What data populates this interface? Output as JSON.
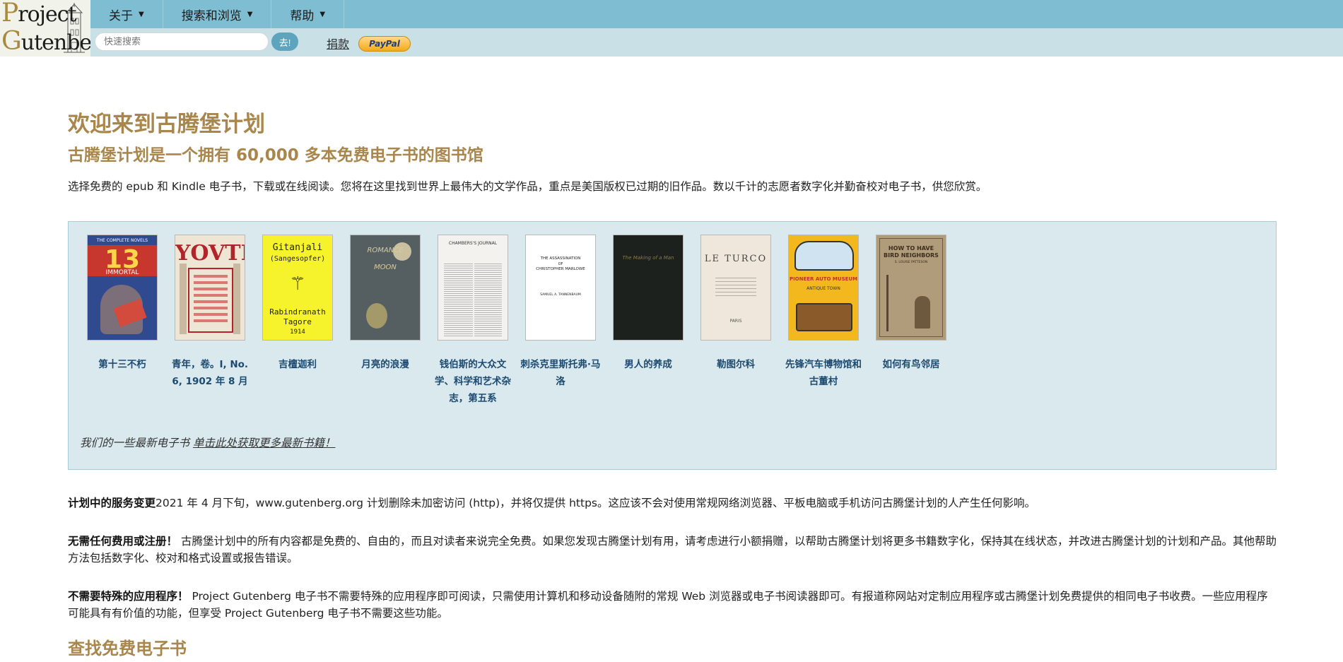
{
  "header": {
    "logo": {
      "line1": "Project",
      "line2": "Gutenberg"
    },
    "nav": [
      {
        "label": "关于"
      },
      {
        "label": "搜索和浏览"
      },
      {
        "label": "帮助"
      }
    ],
    "search": {
      "placeholder": "快速搜索",
      "value": ""
    },
    "go_label": "去!",
    "donate_label": "捐款",
    "paypal_label": "PayPal"
  },
  "main": {
    "title": "欢迎来到古腾堡计划",
    "subtitle": "古腾堡计划是一个拥有 60,000 多本免费电子书的图书馆",
    "intro": "选择免费的 epub 和 Kindle 电子书，下载或在线阅读。您将在这里找到世界上最伟大的文学作品，重点是美国版权已过期的旧作品。数以千计的志愿者数字化并勤奋校对电子书，供您欣赏。",
    "books": [
      {
        "title": "第十三不朽",
        "cover": {
          "top": "THE COMPLETE NOVELS",
          "big": "13",
          "small": "IMMORTAL",
          "bg": "#2f4a8e"
        }
      },
      {
        "title": "青年，卷。I, No. 6, 1902 年 8 月",
        "cover": {
          "big": "YOVTH",
          "bg": "#efe5d4"
        }
      },
      {
        "title": "吉檀迦利",
        "cover": {
          "t1": "Gitanjali",
          "t2": "(Sangesopfer)",
          "t3": "Rabindranath",
          "t4": "Tagore",
          "t5": "1914",
          "bg": "#f6f22b"
        }
      },
      {
        "title": "月亮的浪漫",
        "cover": {
          "t1": "ROMANCE",
          "t2": "MOON",
          "bg": "#555f62"
        }
      },
      {
        "title": "钱伯斯的大众文学、科学和艺术杂志，第五系",
        "cover": {
          "t1": "CHAMBERS'S JOURNAL",
          "bg": "#f4f2ee"
        }
      },
      {
        "title": "刺杀克里斯托弗·马洛",
        "cover": {
          "t1": "THE ASSASSINATION",
          "t2": "OF",
          "t3": "CHRISTOPHER MARLOWE",
          "t4": "SAMUEL A. TANNENBAUM",
          "bg": "#ffffff"
        }
      },
      {
        "title": "男人的养成",
        "cover": {
          "t1": "The Making of a Man",
          "bg": "#1c211e"
        }
      },
      {
        "title": "勒图尔科",
        "cover": {
          "t1": "LE TURCO",
          "t2": "PARIS",
          "bg": "#efe7dc"
        }
      },
      {
        "title": "先锋汽车博物馆和古董村",
        "cover": {
          "t1": "PIONEER AUTO MUSEUM",
          "t2": "ANTIQUE TOWN",
          "bg": "#f3b81e"
        }
      },
      {
        "title": "如何有鸟邻居",
        "cover": {
          "t1": "HOW TO HAVE",
          "t2": "BIRD NEIGHBORS",
          "t3": "S. LOUISE PATTESON",
          "bg": "#b09b7b"
        }
      }
    ],
    "latest_text": "我们的一些最新电子书",
    "latest_link": "单击此处获取更多最新书籍！",
    "notices": [
      {
        "bold": "计划中的服务变更",
        "text": "2021 年 4 月下旬，www.gutenberg.org 计划删除未加密访问 (http)，并将仅提供 https。这应该不会对使用常规网络浏览器、平板电脑或手机访问古腾堡计划的人产生任何影响。"
      },
      {
        "bold": "无需任何费用或注册！",
        "text": "古腾堡计划中的所有内容都是免费的、自由的，而且对读者来说完全免费。如果您发现古腾堡计划有用，请考虑进行小额捐赠，以帮助古腾堡计划将更多书籍数字化，保持其在线状态，并改进古腾堡计划的计划和产品。其他帮助方法包括数字化、校对和格式设置或报告错误。"
      },
      {
        "bold": "不需要特殊的应用程序！",
        "text": "Project Gutenberg 电子书不需要特殊的应用程序即可阅读，只需使用计算机和移动设备随附的常规 Web 浏览器或电子书阅读器即可。有报道称网站对定制应用程序或古腾堡计划免费提供的相同电子书收费。一些应用程序可能具有有价值的功能，但享受 Project Gutenberg 电子书不需要这些功能。"
      }
    ],
    "find_heading": "查找免费电子书"
  }
}
